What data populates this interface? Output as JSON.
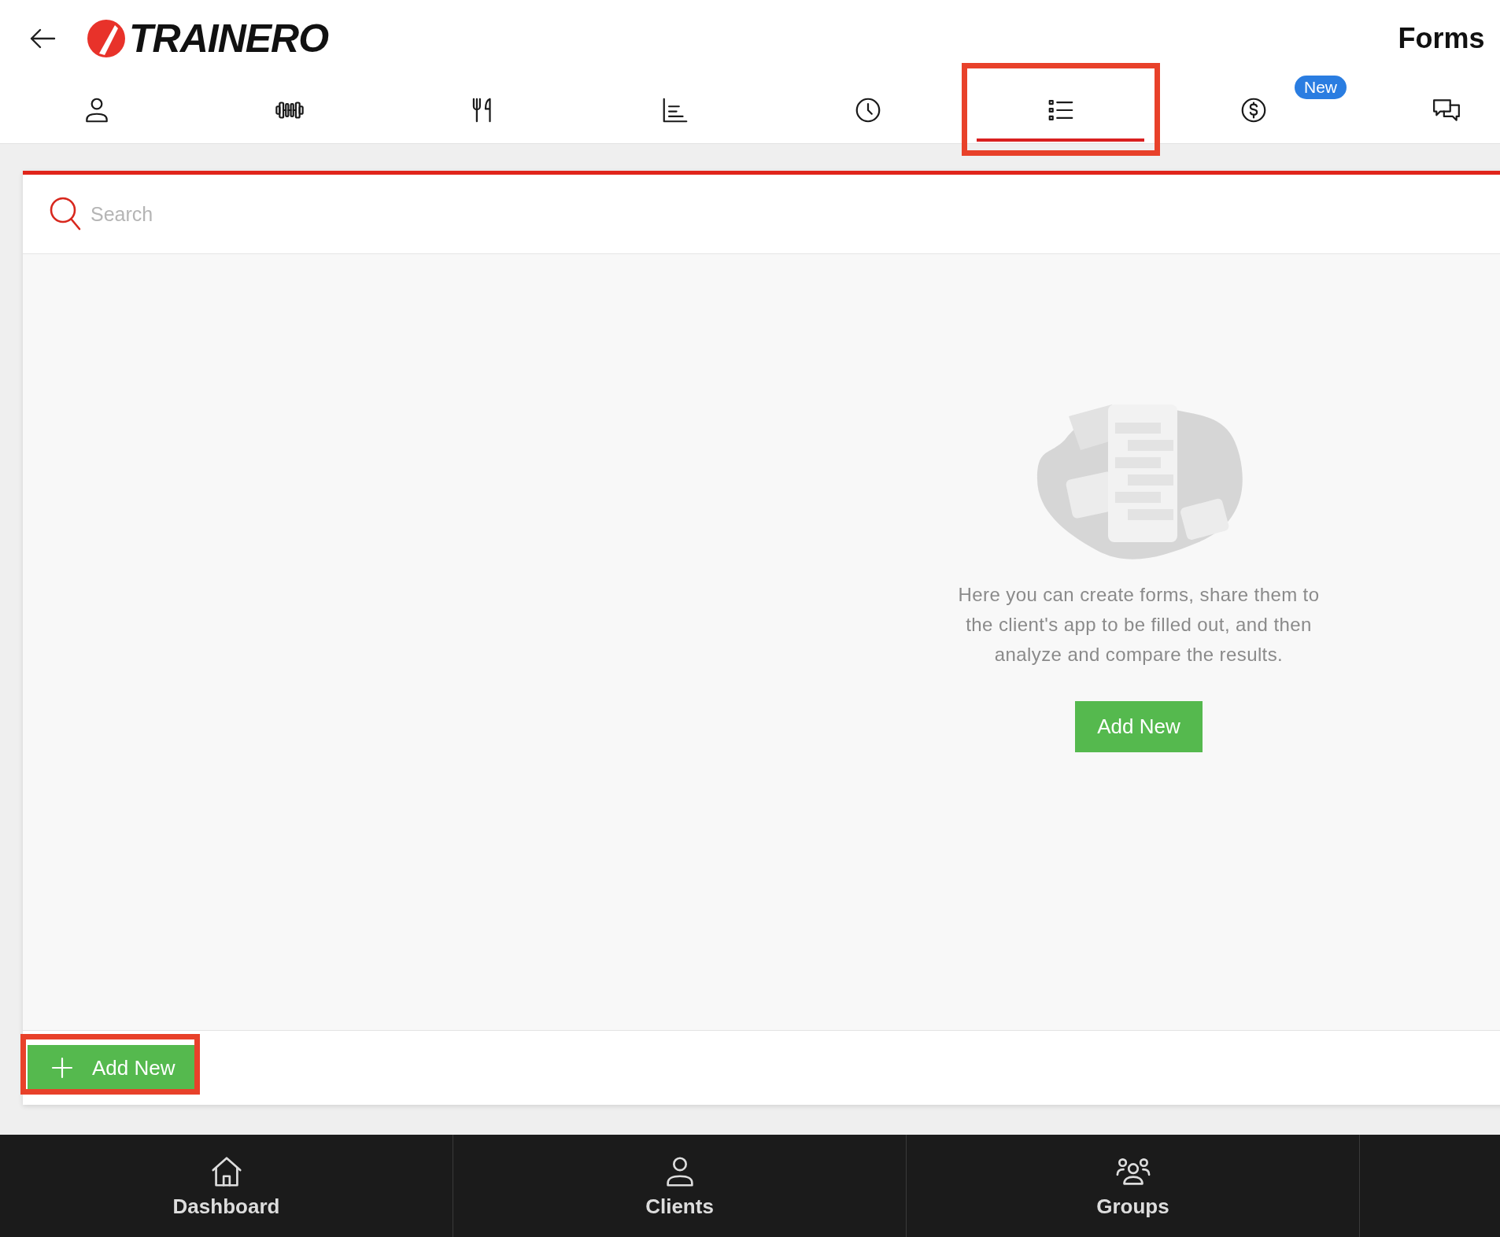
{
  "header": {
    "logo_text": "TRAINERO",
    "title": "Forms"
  },
  "tabs": [
    {
      "kind": "person",
      "selected": false,
      "highlighted": false
    },
    {
      "kind": "dumbbell",
      "selected": false,
      "highlighted": false
    },
    {
      "kind": "cutlery",
      "selected": false,
      "highlighted": false
    },
    {
      "kind": "chart",
      "selected": false,
      "highlighted": false
    },
    {
      "kind": "clock",
      "selected": false,
      "highlighted": false
    },
    {
      "kind": "list",
      "selected": true,
      "highlighted": true
    },
    {
      "kind": "dollar",
      "selected": false,
      "highlighted": false,
      "badge": "New"
    },
    {
      "kind": "chat",
      "selected": false,
      "highlighted": false
    }
  ],
  "search": {
    "placeholder": "Search"
  },
  "empty_state": {
    "message": "Here you can create forms, share them to the client's app to be filled out, and then analyze and compare the results.",
    "button": "Add New"
  },
  "footer": {
    "button": "Add New",
    "highlighted": true
  },
  "bottom_nav": [
    {
      "kind": "home",
      "label": "Dashboard"
    },
    {
      "kind": "person",
      "label": "Clients"
    },
    {
      "kind": "group",
      "label": "Groups"
    },
    {
      "kind": "blank"
    }
  ]
}
